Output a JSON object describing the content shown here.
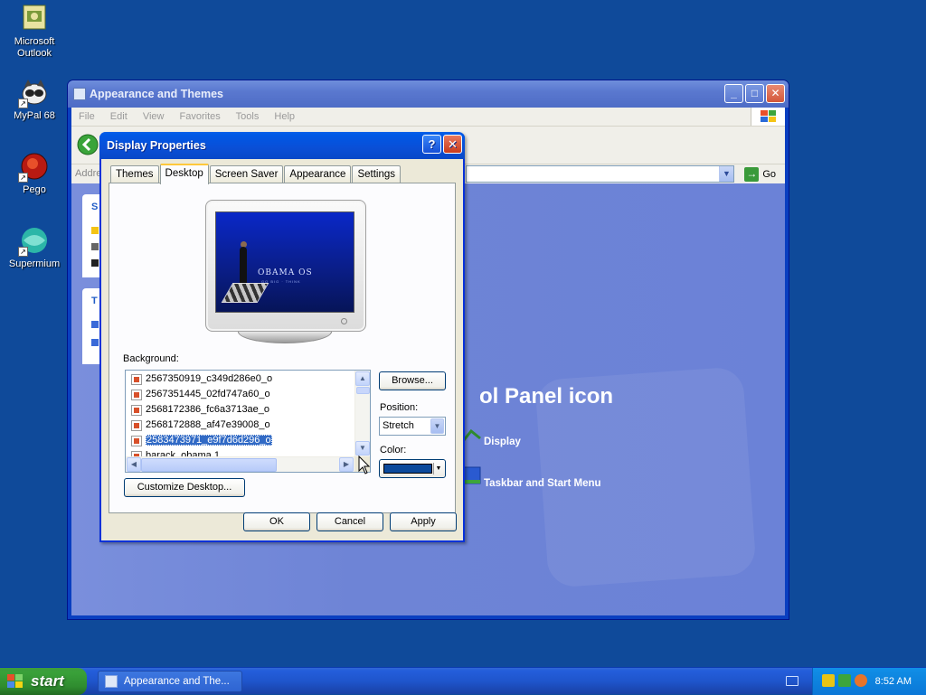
{
  "desktop": {
    "icons": [
      {
        "label": "Microsoft Outlook"
      },
      {
        "label": "MyPal 68"
      },
      {
        "label": "Pego"
      },
      {
        "label": "Supermium"
      }
    ]
  },
  "control_panel": {
    "title": "Appearance and Themes",
    "menu": [
      "File",
      "Edit",
      "View",
      "Favorites",
      "Tools",
      "Help"
    ],
    "address_label": "Addre",
    "go_label": "Go",
    "side_panels": [
      {
        "header": "S"
      },
      {
        "header": "T"
      }
    ],
    "heading_partial": "ol Panel icon",
    "tasks": [
      "Display",
      "Taskbar and Start Menu"
    ]
  },
  "dialog": {
    "title": "Display Properties",
    "tabs": [
      "Themes",
      "Desktop",
      "Screen Saver",
      "Appearance",
      "Settings"
    ],
    "active_tab": "Desktop",
    "preview_text": "OBAMA OS",
    "preview_subtext": "GO BIG · THINK",
    "background_label": "Background:",
    "background_items": [
      "2567350919_c349d286e0_o",
      "2567351445_02fd747a60_o",
      "2568172386_fc6a3713ae_o",
      "2568172888_af47e39008_o",
      "2583473971_e9f7d6d296_o",
      "barack_obama 1"
    ],
    "selected_item": "2583473971_e9f7d6d296_o",
    "browse_label": "Browse...",
    "position_label": "Position:",
    "position_value": "Stretch",
    "color_label": "Color:",
    "color_value": "#0c4a9c",
    "customize_label": "Customize Desktop...",
    "ok_label": "OK",
    "cancel_label": "Cancel",
    "apply_label": "Apply"
  },
  "taskbar": {
    "start_label": "start",
    "task_label": "Appearance and The...",
    "clock": "8:52 AM"
  }
}
